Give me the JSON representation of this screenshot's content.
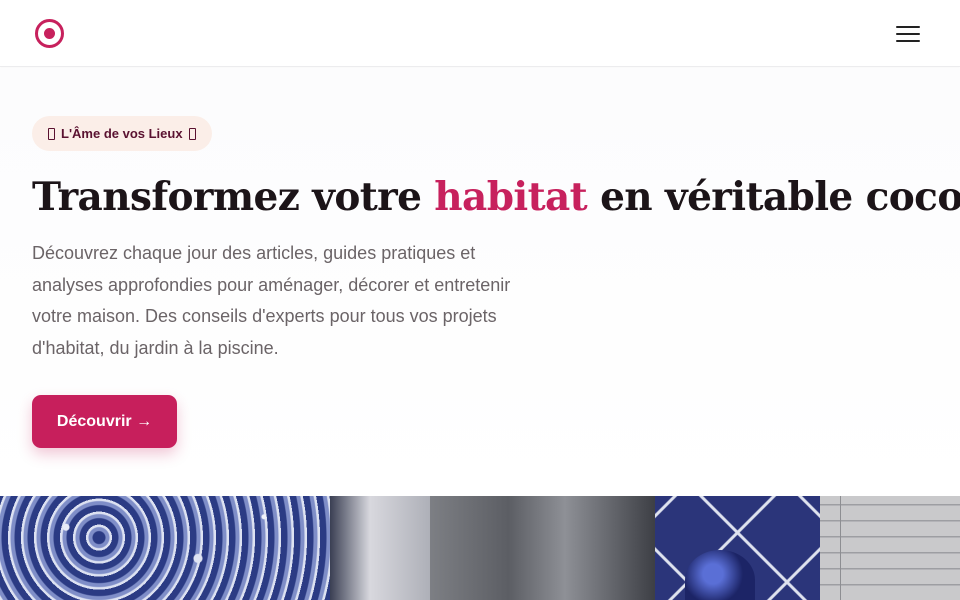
{
  "header": {
    "logo_icon": "target-dot-icon",
    "menu_icon": "hamburger-menu-icon",
    "brand_color": "#c7215d"
  },
  "hero": {
    "badge": "L'Âme de vos Lieux",
    "headline": {
      "before": "Transformez votre ",
      "accent": "habitat",
      "after": " en véritable cocon"
    },
    "lead": "Découvrez chaque jour des articles, guides pratiques et analyses approfondies pour aménager, décorer et entretenir votre maison. Des conseils d'experts pour tous vos projets d'habitat, du jardin à la piscine.",
    "cta_label": "Découvrir →"
  },
  "hero_image": {
    "description_icon": "interior-photo"
  }
}
